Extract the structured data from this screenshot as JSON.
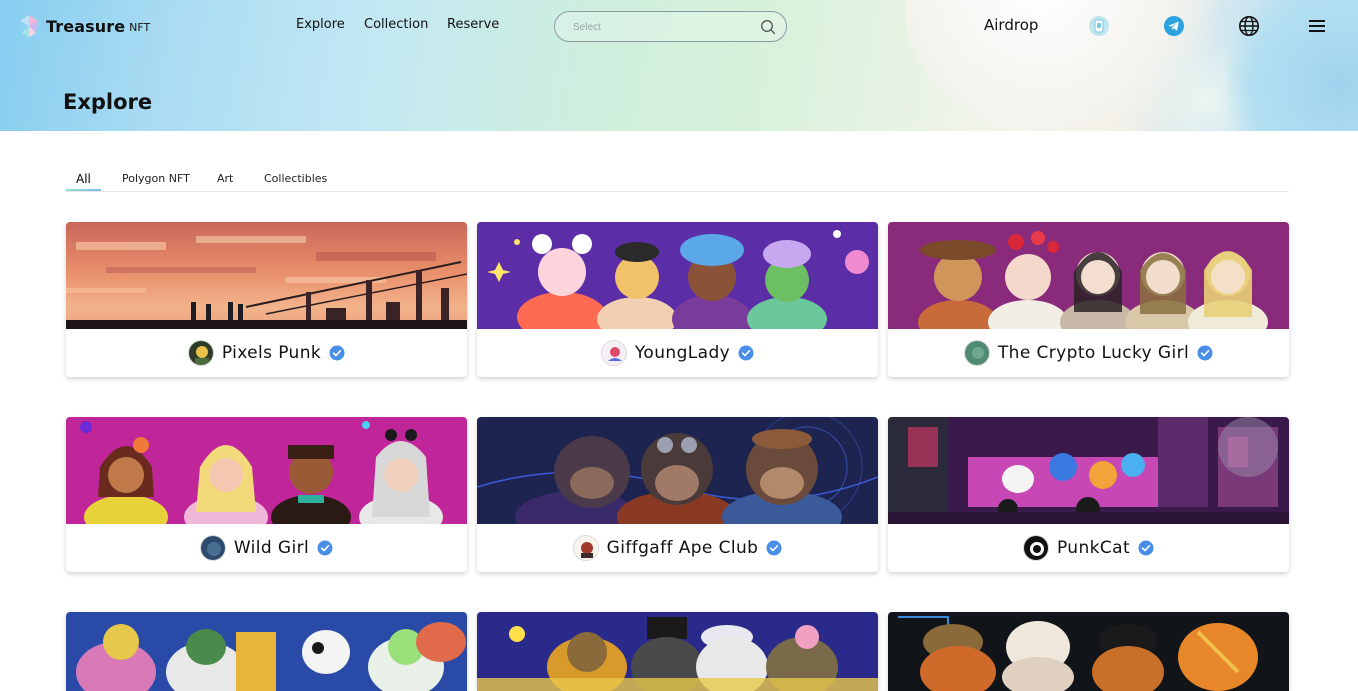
{
  "brand": {
    "name": "Treasure",
    "suffix": "NFT"
  },
  "nav": {
    "explore": "Explore",
    "collection": "Collection",
    "reserve": "Reserve",
    "airdrop": "Airdrop"
  },
  "search": {
    "placeholder": "Select"
  },
  "page": {
    "title": "Explore"
  },
  "tabs": [
    {
      "label": "All",
      "active": true
    },
    {
      "label": "Polygon NFT",
      "active": false
    },
    {
      "label": "Art",
      "active": false
    },
    {
      "label": "Collectibles",
      "active": false
    }
  ],
  "collections": [
    {
      "name": "Pixels Punk",
      "verified": true
    },
    {
      "name": "YoungLady",
      "verified": true
    },
    {
      "name": "The Crypto Lucky Girl",
      "verified": true
    },
    {
      "name": "Wild Girl",
      "verified": true
    },
    {
      "name": "Giffgaff Ape Club",
      "verified": true
    },
    {
      "name": "PunkCat",
      "verified": true
    }
  ],
  "icons": [
    "treasure-logo-icon",
    "search-icon",
    "wallet-icon",
    "telegram-icon",
    "globe-icon",
    "menu-icon",
    "verified-icon"
  ],
  "colors": {
    "accent": "#4a8ee8",
    "telegram": "#2aa3e0",
    "tab_underline": "#8ee0c9"
  }
}
